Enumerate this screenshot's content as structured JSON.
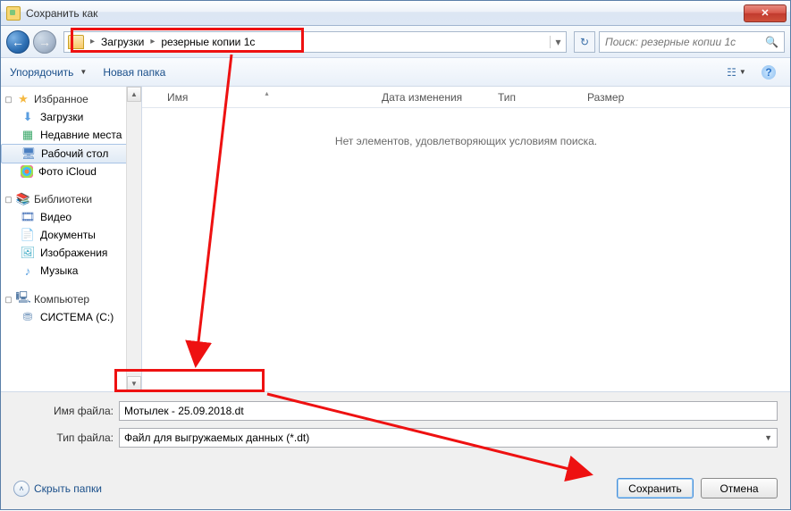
{
  "window": {
    "title": "Сохранить как"
  },
  "nav": {
    "breadcrumb": [
      "Загрузки",
      "резерные копии 1с"
    ],
    "search_placeholder": "Поиск: резерные копии 1с"
  },
  "toolbar": {
    "organize": "Упорядочить",
    "new_folder": "Новая папка"
  },
  "sidebar": {
    "favorites": {
      "label": "Избранное",
      "items": [
        {
          "label": "Загрузки",
          "icon": "dl"
        },
        {
          "label": "Недавние места",
          "icon": "recent"
        },
        {
          "label": "Рабочий стол",
          "icon": "desktop",
          "selected": true
        },
        {
          "label": "Фото iCloud",
          "icon": "cloud"
        }
      ]
    },
    "libraries": {
      "label": "Библиотеки",
      "items": [
        {
          "label": "Видео",
          "icon": "vid"
        },
        {
          "label": "Документы",
          "icon": "doc"
        },
        {
          "label": "Изображения",
          "icon": "img"
        },
        {
          "label": "Музыка",
          "icon": "mus"
        }
      ]
    },
    "computer": {
      "label": "Компьютер",
      "items": [
        {
          "label": "СИСТЕМА (C:)",
          "icon": "drive"
        }
      ]
    }
  },
  "columns": {
    "name": "Имя",
    "date": "Дата изменения",
    "type": "Тип",
    "size": "Размер"
  },
  "list": {
    "empty_msg": "Нет элементов, удовлетворяющих условиям поиска."
  },
  "form": {
    "filename_label": "Имя файла:",
    "filename_value": "Мотылек - 25.09.2018.dt",
    "filetype_label": "Тип файла:",
    "filetype_value": "Файл для выгружаемых данных (*.dt)"
  },
  "actions": {
    "hide_folders": "Скрыть папки",
    "save": "Сохранить",
    "cancel": "Отмена"
  }
}
